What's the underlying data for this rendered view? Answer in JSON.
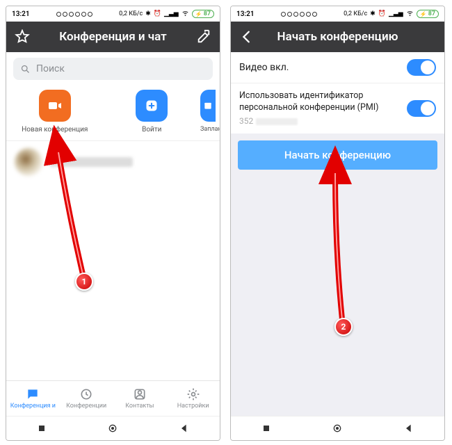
{
  "statusbar": {
    "time": "13:21",
    "data_rate": "0,2 КБ/с",
    "battery": "87"
  },
  "screen1": {
    "header": {
      "title": "Конференция и чат"
    },
    "search": {
      "placeholder": "Поиск"
    },
    "actions": {
      "new_conf": "Новая конференция",
      "join": "Войти",
      "schedule": "Заплан"
    },
    "tabs": {
      "chat": "Конференция и",
      "meetings": "Конференции",
      "contacts": "Контакты",
      "settings": "Настройки"
    },
    "step": "1"
  },
  "screen2": {
    "header": {
      "title": "Начать конференцию"
    },
    "settings": {
      "video_on": "Видео вкл.",
      "use_pmi": "Использовать идентификатор персональной конференции (PMI)",
      "pmi_prefix": "352"
    },
    "start_button": "Начать конференцию",
    "step": "2"
  }
}
